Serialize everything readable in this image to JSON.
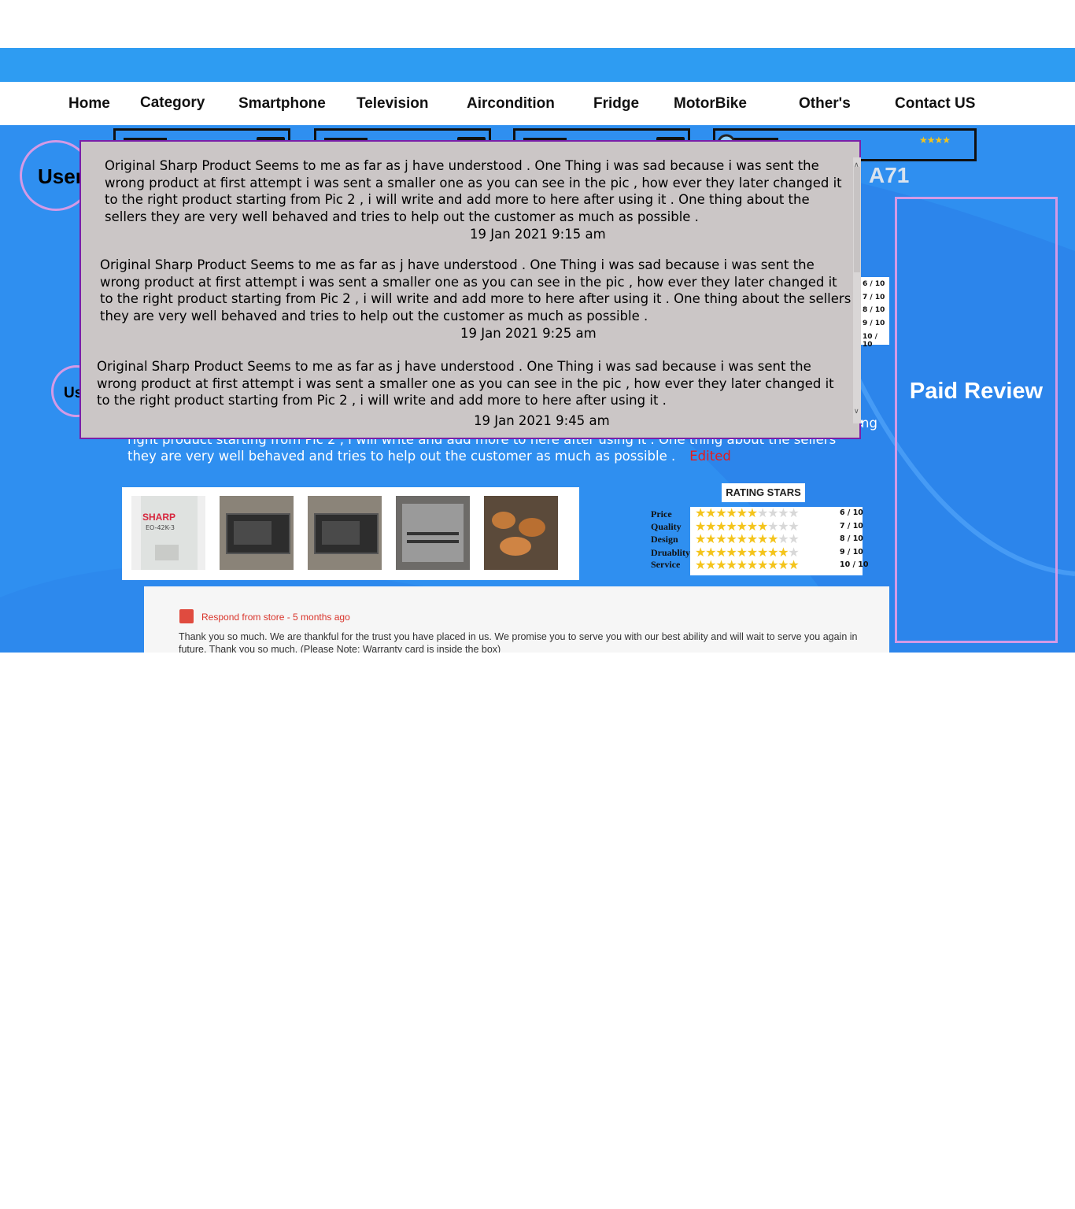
{
  "nav": {
    "home": "Home",
    "category": "Category",
    "smartphone": "Smartphone",
    "television": "Television",
    "aircondition": "Aircondition",
    "fridge": "Fridge",
    "motorbike": "MotorBike",
    "others": "Other's",
    "contact": "Contact US"
  },
  "user_label": "User",
  "user_label_partial": "Us",
  "model_title_partial": "A71",
  "paid_review_label": "Paid Review",
  "review_text": "Original Sharp Product Seems to me as far as j have understood . One Thing i was sad because i was sent the wrong product at first attempt i was sent a smaller one as you can see in the pic , how ever they later changed it to the right product starting from Pic 2 , i will write and add more to here after using it . One thing about the sellers they are very well behaved and tries to help out the customer as much as possible .",
  "review_text_visible": "product at first attempt i was sent a smaller one as you can see in the pic , how ever they later changed it to the right product starting from Pic 2 , i will write and add more to here after using it . One thing about the sellers they are very well behaved and tries to help out the customer as much as possible .",
  "edited_label": "Edited",
  "wrong_tail": "ng",
  "gallery": [
    {
      "name": "sharp-box-photo",
      "caption": "EO-42K-3",
      "brand": "SHARP"
    },
    {
      "name": "oven-photo-1"
    },
    {
      "name": "oven-photo-2"
    },
    {
      "name": "oven-interior-photo"
    },
    {
      "name": "baked-food-photo"
    }
  ],
  "rating": {
    "title": "RATING STARS",
    "rows": [
      {
        "label": "Price",
        "value": 6,
        "max": 10,
        "display": "6 / 10"
      },
      {
        "label": "Quality",
        "value": 7,
        "max": 10,
        "display": "7 / 10"
      },
      {
        "label": "Design",
        "value": 8,
        "max": 10,
        "display": "8 / 10"
      },
      {
        "label": "Druablity",
        "value": 9,
        "max": 10,
        "display": "9 / 10"
      },
      {
        "label": "Service",
        "value": 10,
        "max": 10,
        "display": "10 / 10"
      }
    ]
  },
  "rating_small_scores": [
    "6 / 10",
    "7 / 10",
    "8 / 10",
    "9 / 10",
    "10 / 10"
  ],
  "respond": {
    "header": "Respond from store - 5 months ago",
    "body": "Thank you so much. We are thankful for the trust you have placed in us. We promise you to serve you with our best ability and will wait to serve you again in future. Thank you so much. (Please Note: Warranty card is inside the box)"
  },
  "history": [
    {
      "text": "Original Sharp Product Seems to me as far as j have understood . One Thing i was sad because i was sent the wrong product at first attempt i was sent a smaller one as you can see in the pic , how ever they later changed it to the right product starting from Pic 2 , i will write and add more to here after using it . One thing about the sellers they are very well behaved and tries to help out the customer as much as possible .",
      "date": "19 Jan 2021 9:15 am"
    },
    {
      "text": "Original Sharp Product Seems to me as far as j have understood . One Thing i was sad because i was sent the wrong product at first attempt i was sent a smaller one as you can see in the pic , how ever they later changed it to the right product starting from Pic 2 , i will write and add more to here after using it . One thing about the sellers they are very well behaved and tries to help out the customer as much as possible .",
      "date": "19 Jan 2021 9:25 am"
    },
    {
      "text": "Original Sharp Product Seems to me as far as j have understood . One Thing i was sad because i was sent the wrong product at first attempt i was sent a smaller one as you can see in the pic , how ever they later changed it to the right product starting from Pic 2 , i will write and add more to here after using it .",
      "date": "19 Jan 2021 9:45 am"
    }
  ],
  "colors": {
    "top_band": "#2e9cf2",
    "stage_bg": "#2f8ff0",
    "modal_bg": "#cbc6c6",
    "modal_border": "#7a1fa8",
    "accent_pink": "#d49ae6",
    "edited_red": "#e81b1b",
    "star_gold": "#f4c41b"
  }
}
